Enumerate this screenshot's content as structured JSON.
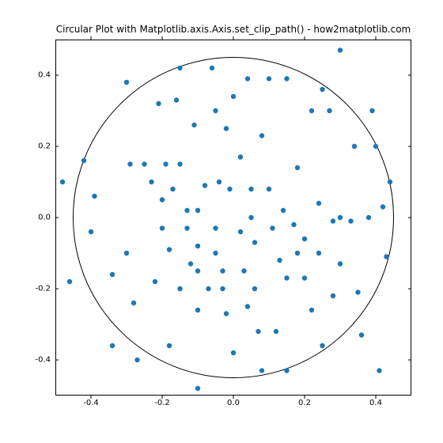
{
  "chart_data": {
    "type": "scatter",
    "title": "Circular Plot with Matplotlib.axis.Axis.set_clip_path() - how2matplotlib.com",
    "xlabel": "",
    "ylabel": "",
    "xlim": [
      -0.5,
      0.5
    ],
    "ylim": [
      -0.5,
      0.5
    ],
    "xticks": [
      -0.4,
      -0.2,
      0.0,
      0.2,
      0.4
    ],
    "yticks": [
      -0.4,
      -0.2,
      0.0,
      0.2,
      0.4
    ],
    "xtick_labels": [
      "-0.4",
      "-0.2",
      "0.0",
      "0.2",
      "0.4"
    ],
    "ytick_labels": [
      "-0.4",
      "-0.2",
      "0.0",
      "0.2",
      "0.4"
    ],
    "circle": {
      "cx": 0.0,
      "cy": 0.0,
      "r": 0.45
    },
    "point_color": "#1f77b4",
    "points": [
      {
        "x": -0.48,
        "y": 0.1
      },
      {
        "x": -0.46,
        "y": -0.18
      },
      {
        "x": -0.42,
        "y": 0.16
      },
      {
        "x": -0.4,
        "y": -0.04
      },
      {
        "x": -0.39,
        "y": 0.06
      },
      {
        "x": -0.34,
        "y": -0.16
      },
      {
        "x": -0.34,
        "y": -0.36
      },
      {
        "x": -0.3,
        "y": 0.38
      },
      {
        "x": -0.3,
        "y": -0.1
      },
      {
        "x": -0.29,
        "y": 0.15
      },
      {
        "x": -0.28,
        "y": -0.24
      },
      {
        "x": -0.27,
        "y": -0.4
      },
      {
        "x": -0.25,
        "y": 0.15
      },
      {
        "x": -0.23,
        "y": 0.1
      },
      {
        "x": -0.22,
        "y": -0.18
      },
      {
        "x": -0.21,
        "y": 0.32
      },
      {
        "x": -0.2,
        "y": 0.05
      },
      {
        "x": -0.2,
        "y": -0.03
      },
      {
        "x": -0.19,
        "y": 0.15
      },
      {
        "x": -0.18,
        "y": -0.09
      },
      {
        "x": -0.18,
        "y": -0.36
      },
      {
        "x": -0.17,
        "y": 0.08
      },
      {
        "x": -0.16,
        "y": 0.33
      },
      {
        "x": -0.15,
        "y": 0.42
      },
      {
        "x": -0.15,
        "y": 0.15
      },
      {
        "x": -0.15,
        "y": -0.2
      },
      {
        "x": -0.13,
        "y": 0.02
      },
      {
        "x": -0.13,
        "y": -0.03
      },
      {
        "x": -0.12,
        "y": -0.13
      },
      {
        "x": -0.11,
        "y": 0.26
      },
      {
        "x": -0.1,
        "y": 0.02
      },
      {
        "x": -0.1,
        "y": -0.08
      },
      {
        "x": -0.1,
        "y": -0.15
      },
      {
        "x": -0.1,
        "y": -0.26
      },
      {
        "x": -0.1,
        "y": -0.48
      },
      {
        "x": -0.08,
        "y": 0.09
      },
      {
        "x": -0.07,
        "y": -0.2
      },
      {
        "x": -0.06,
        "y": 0.42
      },
      {
        "x": -0.05,
        "y": 0.3
      },
      {
        "x": -0.05,
        "y": -0.03
      },
      {
        "x": -0.05,
        "y": -0.1
      },
      {
        "x": -0.04,
        "y": 0.1
      },
      {
        "x": -0.03,
        "y": -0.15
      },
      {
        "x": -0.03,
        "y": -0.2
      },
      {
        "x": -0.02,
        "y": 0.25
      },
      {
        "x": -0.02,
        "y": -0.27
      },
      {
        "x": -0.01,
        "y": 0.08
      },
      {
        "x": 0.0,
        "y": 0.34
      },
      {
        "x": 0.0,
        "y": -0.38
      },
      {
        "x": 0.02,
        "y": 0.17
      },
      {
        "x": 0.02,
        "y": -0.04
      },
      {
        "x": 0.03,
        "y": -0.15
      },
      {
        "x": 0.04,
        "y": 0.39
      },
      {
        "x": 0.04,
        "y": -0.25
      },
      {
        "x": 0.05,
        "y": 0.08
      },
      {
        "x": 0.05,
        "y": 0.0
      },
      {
        "x": 0.06,
        "y": -0.07
      },
      {
        "x": 0.06,
        "y": -0.2
      },
      {
        "x": 0.07,
        "y": -0.32
      },
      {
        "x": 0.08,
        "y": 0.23
      },
      {
        "x": 0.08,
        "y": -0.43
      },
      {
        "x": 0.1,
        "y": 0.39
      },
      {
        "x": 0.1,
        "y": 0.08
      },
      {
        "x": 0.11,
        "y": -0.03
      },
      {
        "x": 0.12,
        "y": -0.32
      },
      {
        "x": 0.13,
        "y": -0.12
      },
      {
        "x": 0.14,
        "y": 0.02
      },
      {
        "x": 0.15,
        "y": 0.39
      },
      {
        "x": 0.15,
        "y": -0.17
      },
      {
        "x": 0.15,
        "y": -0.43
      },
      {
        "x": 0.17,
        "y": -0.02
      },
      {
        "x": 0.18,
        "y": 0.14
      },
      {
        "x": 0.18,
        "y": -0.1
      },
      {
        "x": 0.2,
        "y": -0.06
      },
      {
        "x": 0.2,
        "y": -0.17
      },
      {
        "x": 0.22,
        "y": 0.3
      },
      {
        "x": 0.22,
        "y": -0.26
      },
      {
        "x": 0.24,
        "y": 0.04
      },
      {
        "x": 0.24,
        "y": -0.1
      },
      {
        "x": 0.25,
        "y": 0.36
      },
      {
        "x": 0.25,
        "y": -0.36
      },
      {
        "x": 0.27,
        "y": 0.3
      },
      {
        "x": 0.28,
        "y": -0.01
      },
      {
        "x": 0.28,
        "y": -0.22
      },
      {
        "x": 0.3,
        "y": 0.47
      },
      {
        "x": 0.3,
        "y": 0.0
      },
      {
        "x": 0.3,
        "y": -0.13
      },
      {
        "x": 0.33,
        "y": -0.01
      },
      {
        "x": 0.34,
        "y": 0.2
      },
      {
        "x": 0.35,
        "y": -0.21
      },
      {
        "x": 0.36,
        "y": -0.33
      },
      {
        "x": 0.38,
        "y": 0.0
      },
      {
        "x": 0.39,
        "y": 0.3
      },
      {
        "x": 0.4,
        "y": 0.2
      },
      {
        "x": 0.41,
        "y": -0.43
      },
      {
        "x": 0.42,
        "y": 0.03
      },
      {
        "x": 0.43,
        "y": -0.11
      },
      {
        "x": 0.44,
        "y": 0.1
      }
    ]
  }
}
